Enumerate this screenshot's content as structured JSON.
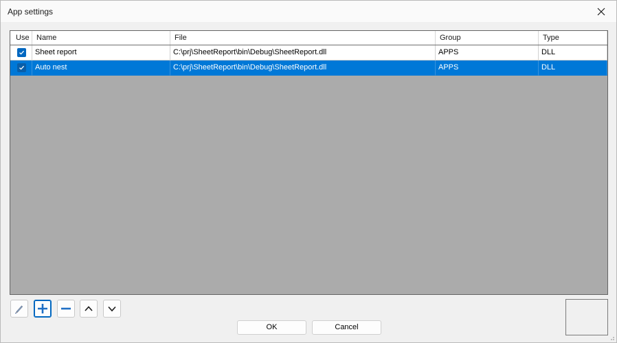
{
  "window": {
    "title": "App settings",
    "close_icon": "close-icon"
  },
  "grid": {
    "columns": [
      "Use",
      "Name",
      "File",
      "Group",
      "Type"
    ],
    "rows": [
      {
        "use": true,
        "name": "Sheet report",
        "file": "C:\\prj\\SheetReport\\bin\\Debug\\SheetReport.dll",
        "group": "APPS",
        "type": "DLL",
        "selected": false
      },
      {
        "use": true,
        "name": "Auto nest",
        "file": "C:\\prj\\SheetReport\\bin\\Debug\\SheetReport.dll",
        "group": "APPS",
        "type": "DLL",
        "selected": true
      }
    ]
  },
  "toolbar": {
    "edit_icon": "pencil-icon",
    "add_icon": "plus-icon",
    "remove_icon": "minus-icon",
    "up_icon": "chevron-up-icon",
    "down_icon": "chevron-down-icon"
  },
  "buttons": {
    "ok_label": "OK",
    "cancel_label": "Cancel"
  },
  "colors": {
    "accent": "#0078d7",
    "checkbox": "#0067c0",
    "grid_background": "#ababab"
  }
}
